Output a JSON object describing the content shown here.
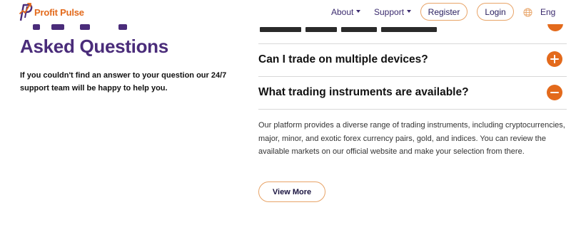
{
  "header": {
    "brand_name": "Profit Pulse",
    "logo_icon": "profit-pulse-logo-icon",
    "nav": {
      "about_label": "About",
      "support_label": "Support"
    },
    "register_label": "Register",
    "login_label": "Login",
    "language_icon": "globe-icon",
    "language_label": "Eng"
  },
  "intro": {
    "title": "Asked Questions",
    "description": "If you couldn't find an answer to your question our 24/7 support team will be happy to help you."
  },
  "faq": {
    "items": [
      {
        "question": "Can I trade on multiple devices?",
        "state": "collapsed",
        "toggle_icon": "plus-icon"
      },
      {
        "question": "What trading instruments are available?",
        "state": "expanded",
        "toggle_icon": "minus-icon",
        "answer": "Our platform provides a diverse range of trading instruments, including cryptocurrencies, major, minor, and exotic forex currency pairs, gold, and indices. You can review the available markets on our official website and make your selection from there."
      }
    ],
    "view_more_label": "View More"
  },
  "colors": {
    "accent": "#e36a1c",
    "heading": "#4a2c7a",
    "nav_text": "#3a2a6e",
    "button_border": "#e8a468",
    "divider": "#d8d8d8"
  }
}
